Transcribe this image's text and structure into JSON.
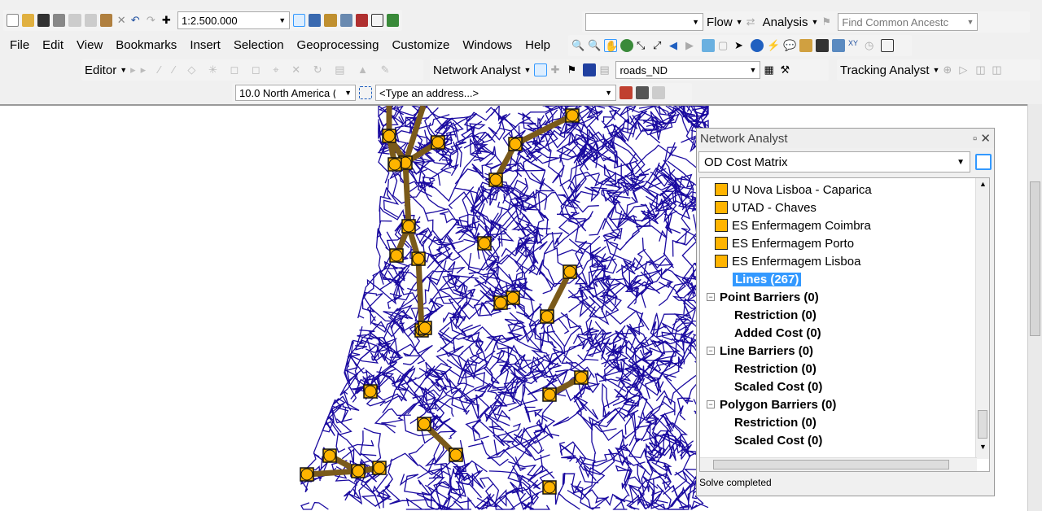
{
  "toolbar": {
    "scale": "1:2.500.000",
    "flow": "Flow",
    "analysis": "Analysis",
    "find_ancestor": "Find Common Ancestc",
    "network_analyst": "Network Analyst",
    "network_dataset": "roads_ND",
    "tracking_analyst": "Tracking Analyst",
    "editor": "Editor",
    "locator": "10.0 North America (",
    "address_placeholder": "<Type an address...>"
  },
  "menu": [
    "File",
    "Edit",
    "View",
    "Bookmarks",
    "Insert",
    "Selection",
    "Geoprocessing",
    "Customize",
    "Windows",
    "Help"
  ],
  "panel": {
    "title": "Network Analyst",
    "analysis_layer": "OD Cost Matrix",
    "items": [
      {
        "label": "U Nova Lisboa - Caparica",
        "type": "point"
      },
      {
        "label": "UTAD - Chaves",
        "type": "point"
      },
      {
        "label": "ES Enfermagem Coimbra",
        "type": "point"
      },
      {
        "label": "ES Enfermagem Porto",
        "type": "point"
      },
      {
        "label": "ES Enfermagem Lisboa",
        "type": "point"
      },
      {
        "label": "Lines (267)",
        "type": "selected"
      },
      {
        "label": "Point Barriers (0)",
        "type": "group"
      },
      {
        "label": "Restriction (0)",
        "type": "sub"
      },
      {
        "label": "Added Cost (0)",
        "type": "sub"
      },
      {
        "label": "Line Barriers (0)",
        "type": "group"
      },
      {
        "label": "Restriction (0)",
        "type": "sub"
      },
      {
        "label": "Scaled Cost (0)",
        "type": "sub"
      },
      {
        "label": "Polygon Barriers (0)",
        "type": "group"
      },
      {
        "label": "Restriction (0)",
        "type": "sub"
      },
      {
        "label": "Scaled Cost (0)",
        "type": "sub"
      }
    ],
    "status": "Solve completed"
  },
  "colors": {
    "roads": "#1a0aa0",
    "routes": "#7a5a1a",
    "points": "#ffb400",
    "selection": "#3399ff"
  }
}
